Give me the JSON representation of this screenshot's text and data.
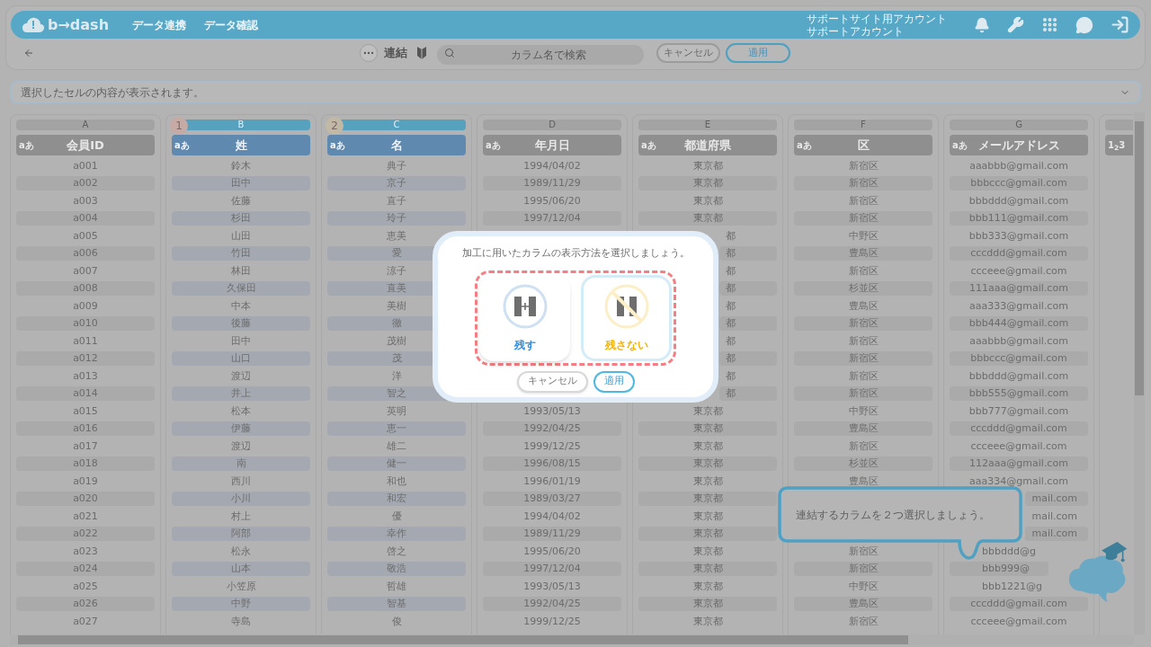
{
  "header": {
    "logo": "b→dash",
    "nav": [
      "データ連携",
      "データ確認"
    ],
    "account": [
      "サポートサイト用アカウント",
      "サポートアカウント"
    ]
  },
  "toolbar": {
    "title": "連結",
    "search": {
      "placeholder": "カラム名で検索"
    },
    "buttons": [
      {
        "label": "キャンセル",
        "kind": "secondary"
      },
      {
        "label": "適用",
        "kind": "primary"
      }
    ]
  },
  "cell_bar": {
    "text": "選択したセルの内容が表示されます。"
  },
  "table": {
    "columns": [
      {
        "letter": "A",
        "type_label": "aあ",
        "name": "会員ID",
        "selected": false
      },
      {
        "letter": "B",
        "type_label": "aあ",
        "name": "姓",
        "selected": true,
        "badge": "1"
      },
      {
        "letter": "C",
        "type_label": "aあ",
        "name": "名",
        "selected": true,
        "badge": "2"
      },
      {
        "letter": "D",
        "type_label": "aあ",
        "name": "年月日",
        "selected": false
      },
      {
        "letter": "E",
        "type_label": "aあ",
        "name": "都道府県",
        "selected": false
      },
      {
        "letter": "F",
        "type_label": "aあ",
        "name": "区",
        "selected": false
      },
      {
        "letter": "G",
        "type_label": "aあ",
        "name": "メールアドレス",
        "selected": false
      },
      {
        "type_label": "1$_{2}$3",
        "selected": false
      }
    ],
    "rows": [
      [
        "a001",
        "鈴木",
        "典子",
        "1994/04/02",
        "東京都",
        "新宿区",
        "aaabbb@gmail.com"
      ],
      [
        "a002",
        "田中",
        "京子",
        "1989/11/29",
        "東京都",
        "新宿区",
        "bbbccc@gmail.com"
      ],
      [
        "a003",
        "佐藤",
        "直子",
        "1995/06/20",
        "東京都",
        "新宿区",
        "bbbddd@gmail.com"
      ],
      [
        "a004",
        "杉田",
        "玲子",
        "1997/12/04",
        "東京都",
        "新宿区",
        "bbb111@gmail.com"
      ],
      [
        "a005",
        "山田",
        "恵美",
        null,
        {
          "text": "都",
          "kind": "cut_left"
        },
        "中野区",
        "bbb333@gmail.com"
      ],
      [
        "a006",
        "竹田",
        "愛",
        null,
        {
          "text": "都",
          "kind": "cut_left"
        },
        "豊島区",
        "cccddd@gmail.com"
      ],
      [
        "a007",
        "林田",
        "涼子",
        null,
        {
          "text": "都",
          "kind": "cut_left"
        },
        "新宿区",
        "ccceee@gmail.com"
      ],
      [
        "a008",
        "久保田",
        "直美",
        null,
        {
          "text": "都",
          "kind": "cut_left"
        },
        "杉並区",
        "111aaa@gmail.com"
      ],
      [
        "a009",
        "中本",
        "美樹",
        null,
        {
          "text": "都",
          "kind": "cut_left"
        },
        "豊島区",
        "aaa333@gmail.com"
      ],
      [
        "a010",
        "後藤",
        "徹",
        null,
        {
          "text": "都",
          "kind": "cut_left"
        },
        "新宿区",
        "bbb444@gmail.com"
      ],
      [
        "a011",
        "田中",
        "茂樹",
        null,
        {
          "text": "都",
          "kind": "cut_left"
        },
        "新宿区",
        "aaabbb@gmail.com"
      ],
      [
        "a012",
        "山口",
        "茂",
        null,
        {
          "text": "都",
          "kind": "cut_left"
        },
        "新宿区",
        "bbbccc@gmail.com"
      ],
      [
        "a013",
        "渡辺",
        "洋",
        null,
        {
          "text": "都",
          "kind": "cut_left"
        },
        "新宿区",
        "bbbddd@gmail.com"
      ],
      [
        "a014",
        "井上",
        "智之",
        null,
        {
          "text": "都",
          "kind": "cut_left"
        },
        "新宿区",
        "bbb555@gmail.com"
      ],
      [
        "a015",
        "松本",
        "英明",
        "1993/05/13",
        "東京都",
        "中野区",
        "bbb777@gmail.com"
      ],
      [
        "a016",
        "伊藤",
        "恵一",
        "1992/04/25",
        "東京都",
        "豊島区",
        "cccddd@gmail.com"
      ],
      [
        "a017",
        "渡辺",
        "雄二",
        "1999/12/25",
        "東京都",
        "新宿区",
        "ccceee@gmail.com"
      ],
      [
        "a018",
        "南",
        "健一",
        "1996/08/15",
        "東京都",
        "杉並区",
        "112aaa@gmail.com"
      ],
      [
        "a019",
        "西川",
        "和也",
        "1996/01/19",
        "東京都",
        "豊島区",
        "aaa334@gmail.com"
      ],
      [
        "a020",
        "小川",
        "和宏",
        "1989/03/27",
        "東京都",
        null,
        {
          "text": "mail.com",
          "kind": "cut_left"
        }
      ],
      [
        "a021",
        "村上",
        "優",
        "1994/04/02",
        "東京都",
        null,
        {
          "text": "mail.com",
          "kind": "cut_left"
        }
      ],
      [
        "a022",
        "阿部",
        "幸作",
        "1989/11/29",
        "東京都",
        null,
        {
          "text": "mail.com",
          "kind": "cut_left"
        }
      ],
      [
        "a023",
        "松永",
        "啓之",
        "1995/06/20",
        "東京都",
        "新宿区",
        {
          "text": "bbbddd@g",
          "kind": "cut_right"
        }
      ],
      [
        "a024",
        "山本",
        "敬浩",
        "1997/12/04",
        "東京都",
        "新宿区",
        {
          "text": "bbb999@",
          "kind": "cut_right"
        }
      ],
      [
        "a025",
        "小笠原",
        "哲雄",
        "1993/05/13",
        "東京都",
        "中野区",
        {
          "text": "bbb1221@g",
          "kind": "cut_right"
        }
      ],
      [
        "a026",
        "中野",
        "智基",
        "1992/04/25",
        "東京都",
        "豊島区",
        "cccddd@gmail.com"
      ],
      [
        "a027",
        "寺島",
        "俊",
        "1999/12/25",
        "東京都",
        "新宿区",
        "ccceee@gmail.com"
      ]
    ]
  },
  "modal": {
    "message": "加工に用いたカラムの表示方法を選択しましょう。",
    "options": [
      {
        "label": "残す",
        "kind": "keep",
        "selected": false
      },
      {
        "label": "残さない",
        "kind": "drop",
        "selected": true
      }
    ],
    "buttons": [
      {
        "label": "キャンセル",
        "kind": "secondary"
      },
      {
        "label": "適用",
        "kind": "primary"
      }
    ]
  },
  "tooltip": {
    "text": "連結するカラムを２つ選択しましょう。"
  }
}
